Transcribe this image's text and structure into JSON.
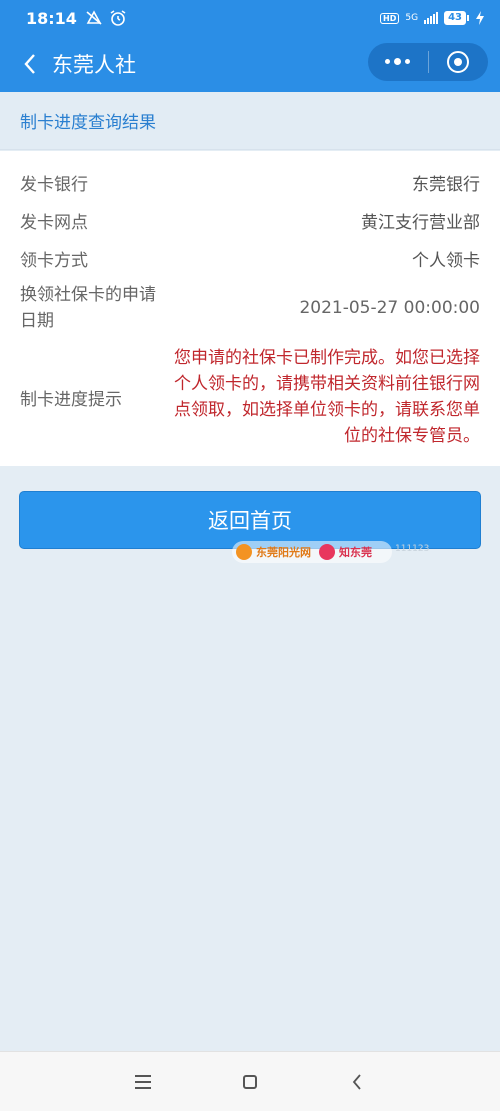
{
  "status_bar": {
    "time": "18:14",
    "hd": "HD",
    "network": "5G",
    "battery": "43"
  },
  "navbar": {
    "title": "东莞人社",
    "back_icon": "chevron-left-icon",
    "more_icon": "more-dots-icon",
    "close_icon": "target-circle-icon"
  },
  "section": {
    "title": "制卡进度查询结果"
  },
  "details": [
    {
      "label": "发卡银行",
      "value": "东莞银行"
    },
    {
      "label": "发卡网点",
      "value": "黄江支行营业部"
    },
    {
      "label": "领卡方式",
      "value": "个人领卡"
    },
    {
      "label": "换领社保卡的申请日期",
      "value": "2021-05-27 00:00:00"
    },
    {
      "label": "制卡进度提示",
      "value": "您申请的社保卡已制作完成。如您已选择个人领卡的，请携带相关资料前往银行网点领取，如选择单位领卡的，请联系您单位的社保专管员。"
    }
  ],
  "button": {
    "home_label": "返回首页"
  },
  "watermark": {
    "text1": "东莞阳光网",
    "text2": "知东莞",
    "id": "111123"
  },
  "colors": {
    "primary": "#2b8ee6",
    "notice": "#c0272d",
    "section_text": "#2a7fd0"
  }
}
